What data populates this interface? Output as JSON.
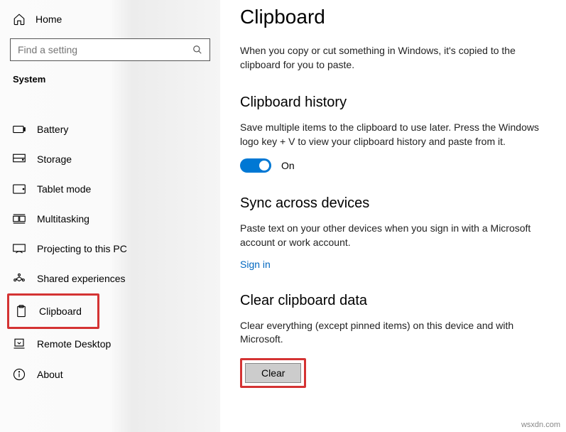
{
  "home_label": "Home",
  "search": {
    "placeholder": "Find a setting"
  },
  "category_label": "System",
  "nav": {
    "battery": "Battery",
    "storage": "Storage",
    "tablet": "Tablet mode",
    "multitasking": "Multitasking",
    "projecting": "Projecting to this PC",
    "shared": "Shared experiences",
    "clipboard": "Clipboard",
    "remote": "Remote Desktop",
    "about": "About"
  },
  "page": {
    "title": "Clipboard",
    "intro": "When you copy or cut something in Windows, it's copied to the clipboard for you to paste.",
    "history": {
      "heading": "Clipboard history",
      "desc": "Save multiple items to the clipboard to use later. Press the Windows logo key + V to view your clipboard history and paste from it.",
      "toggle_state": "On"
    },
    "sync": {
      "heading": "Sync across devices",
      "desc": "Paste text on your other devices when you sign in with a Microsoft account or work account.",
      "signin": "Sign in"
    },
    "clear": {
      "heading": "Clear clipboard data",
      "desc": "Clear everything (except pinned items) on this device and with Microsoft.",
      "button": "Clear"
    }
  },
  "watermark": "wsxdn.com"
}
